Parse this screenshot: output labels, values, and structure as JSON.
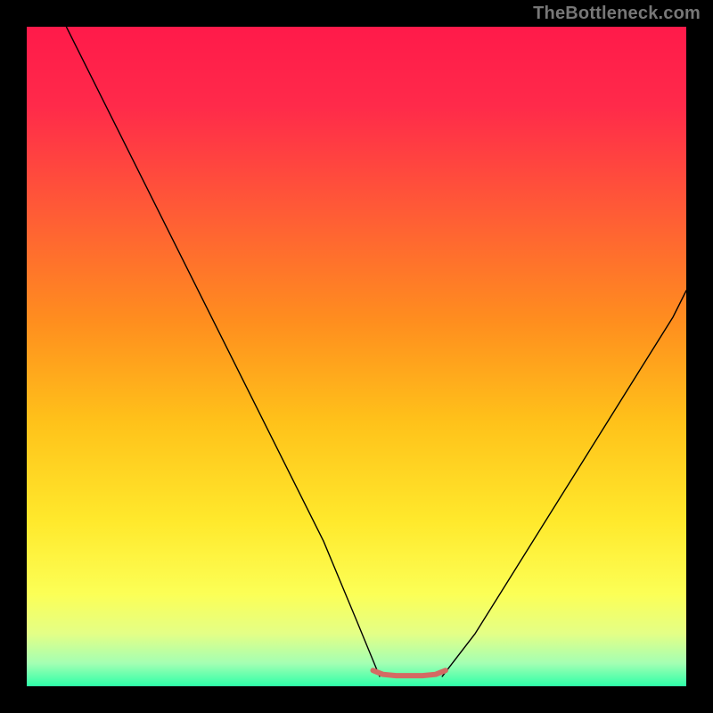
{
  "watermark": "TheBottleneck.com",
  "chart_data": {
    "type": "line",
    "title": "",
    "xlabel": "",
    "ylabel": "",
    "xlim": [
      0,
      100
    ],
    "ylim": [
      0,
      100
    ],
    "grid": false,
    "background_gradient": {
      "stops": [
        {
          "offset": 0.0,
          "color": "#ff1a4a"
        },
        {
          "offset": 0.12,
          "color": "#ff2a4a"
        },
        {
          "offset": 0.28,
          "color": "#ff5b36"
        },
        {
          "offset": 0.45,
          "color": "#ff8f1e"
        },
        {
          "offset": 0.6,
          "color": "#ffc21a"
        },
        {
          "offset": 0.75,
          "color": "#ffe92c"
        },
        {
          "offset": 0.86,
          "color": "#fcff56"
        },
        {
          "offset": 0.92,
          "color": "#e4ff86"
        },
        {
          "offset": 0.965,
          "color": "#a4ffb3"
        },
        {
          "offset": 1.0,
          "color": "#2effa8"
        }
      ]
    },
    "series": [
      {
        "name": "curve-left",
        "color": "#000000",
        "width": 1.4,
        "x": [
          6,
          10,
          15,
          20,
          25,
          30,
          35,
          40,
          45,
          50,
          53.5
        ],
        "y": [
          100,
          92,
          82,
          72,
          62,
          52,
          42,
          32,
          22,
          10,
          1.5
        ]
      },
      {
        "name": "curve-right",
        "color": "#000000",
        "width": 1.4,
        "x": [
          63,
          68,
          73,
          78,
          83,
          88,
          93,
          98,
          100
        ],
        "y": [
          1.5,
          8,
          16,
          24,
          32,
          40,
          48,
          56,
          60
        ]
      },
      {
        "name": "trough-band",
        "color": "#d46a63",
        "width": 6,
        "x": [
          52.5,
          54,
          56,
          58,
          60,
          62,
          63.5
        ],
        "y": [
          2.4,
          1.8,
          1.6,
          1.6,
          1.6,
          1.8,
          2.4
        ]
      }
    ]
  }
}
